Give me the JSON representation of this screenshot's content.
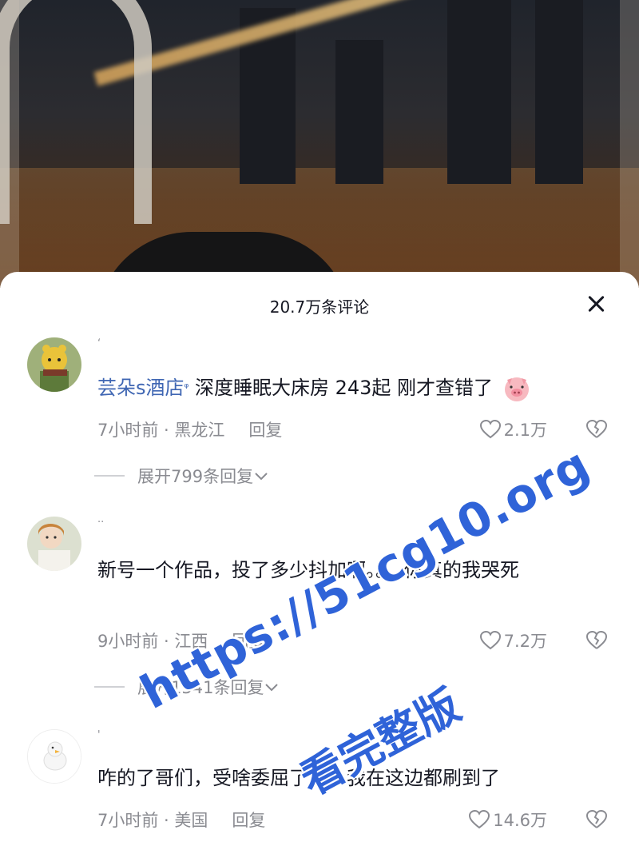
{
  "sheet": {
    "title": "20.7万条评论"
  },
  "comments": [
    {
      "username": "ʻ",
      "mention": "芸朵s酒店",
      "text": "深度睡眠大床房 243起 刚才查错了",
      "time_location": "7小时前 · 黑龙江",
      "reply_label": "回复",
      "likes": "2.1万",
      "expand_label": "展开799条回复",
      "avatar_icon": "yellow-bear-avatar-icon",
      "emoji": "pig-face-icon"
    },
    {
      "username": "··",
      "text": "新号一个作品，投了多少抖加啊。。。你真的我哭死",
      "time_location": "9小时前 · 江西",
      "reply_label": "回复",
      "likes": "7.2万",
      "expand_label": "展开1541条回复",
      "avatar_icon": "girl-avatar-icon"
    },
    {
      "username": "'",
      "text": "咋的了哥们，受啥委屈了啊，我在这边都刷到了",
      "time_location": "7小时前 · 美国",
      "reply_label": "回复",
      "likes": "14.6万",
      "avatar_icon": "white-duck-avatar-icon"
    }
  ],
  "watermark": {
    "url": "https://51cg10.org",
    "text": "看完整版"
  },
  "colors": {
    "mention": "#3f66b3",
    "meta": "#8a8b91",
    "text": "#161823",
    "watermark": "#2f63d8"
  }
}
